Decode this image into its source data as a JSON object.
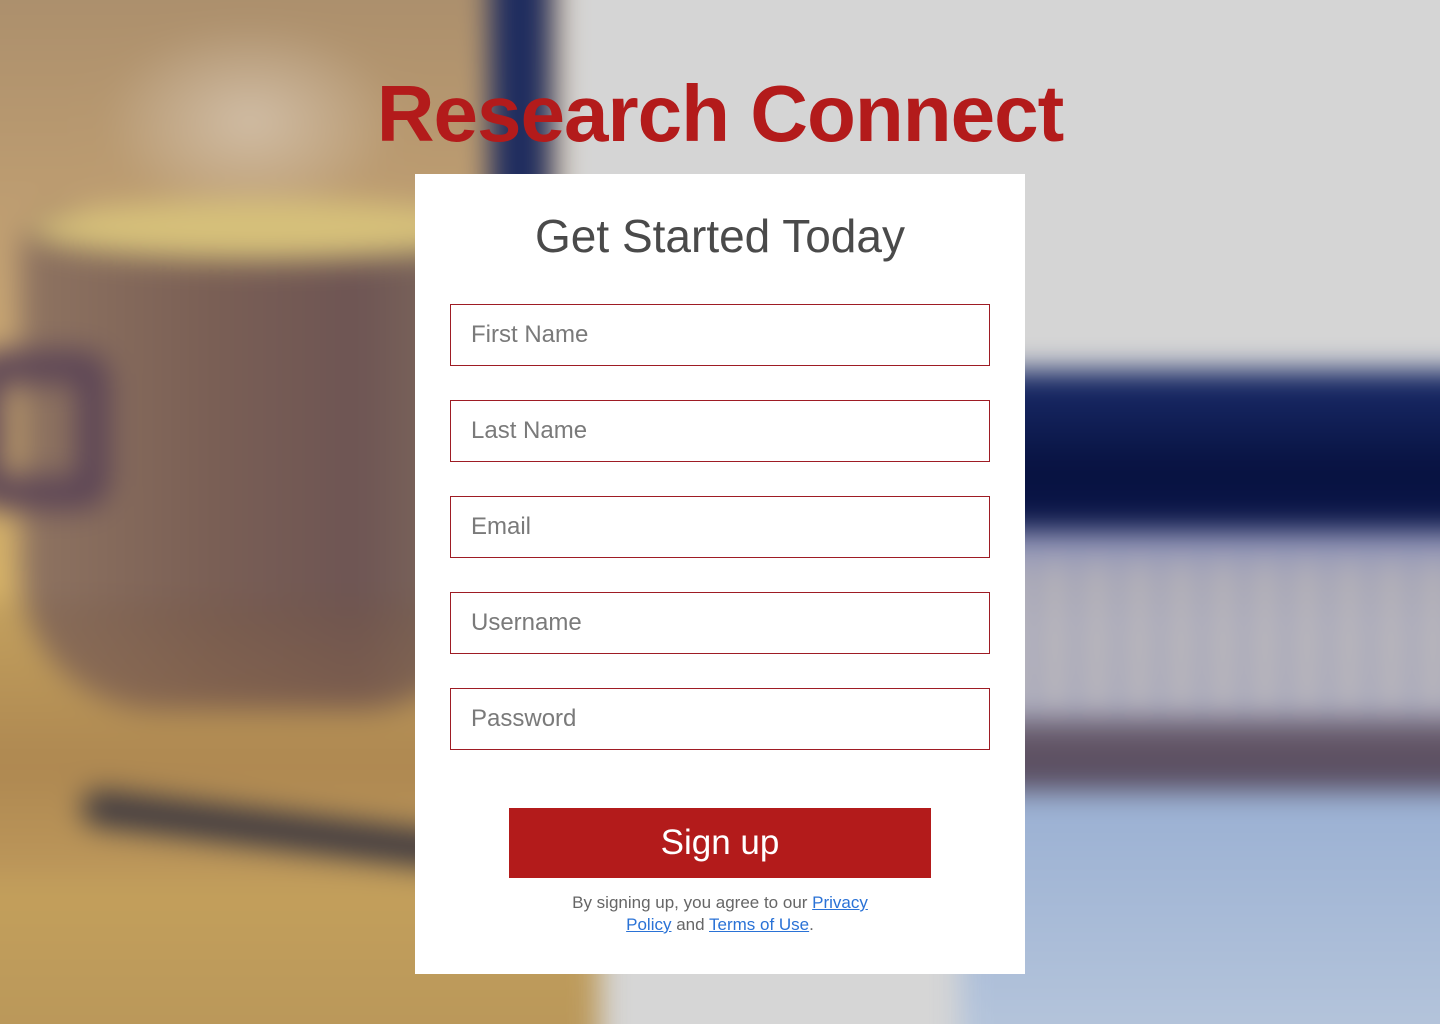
{
  "brand": {
    "title": "Research Connect"
  },
  "form": {
    "heading": "Get Started Today",
    "fields": [
      {
        "placeholder": "First Name",
        "value": ""
      },
      {
        "placeholder": "Last Name",
        "value": ""
      },
      {
        "placeholder": "Email",
        "value": ""
      },
      {
        "placeholder": "Username",
        "value": ""
      },
      {
        "placeholder": "Password",
        "value": ""
      }
    ],
    "submit_label": "Sign up",
    "legal": {
      "prefix": "By signing up, you agree to our ",
      "privacy_link": "Privacy Policy",
      "connector": " and ",
      "terms_link": "Terms of Use",
      "suffix": "."
    }
  },
  "colors": {
    "accent": "#b31b1b",
    "field_border": "#9e1c24",
    "link": "#2a72d6",
    "heading_text": "#4a4a4a"
  }
}
